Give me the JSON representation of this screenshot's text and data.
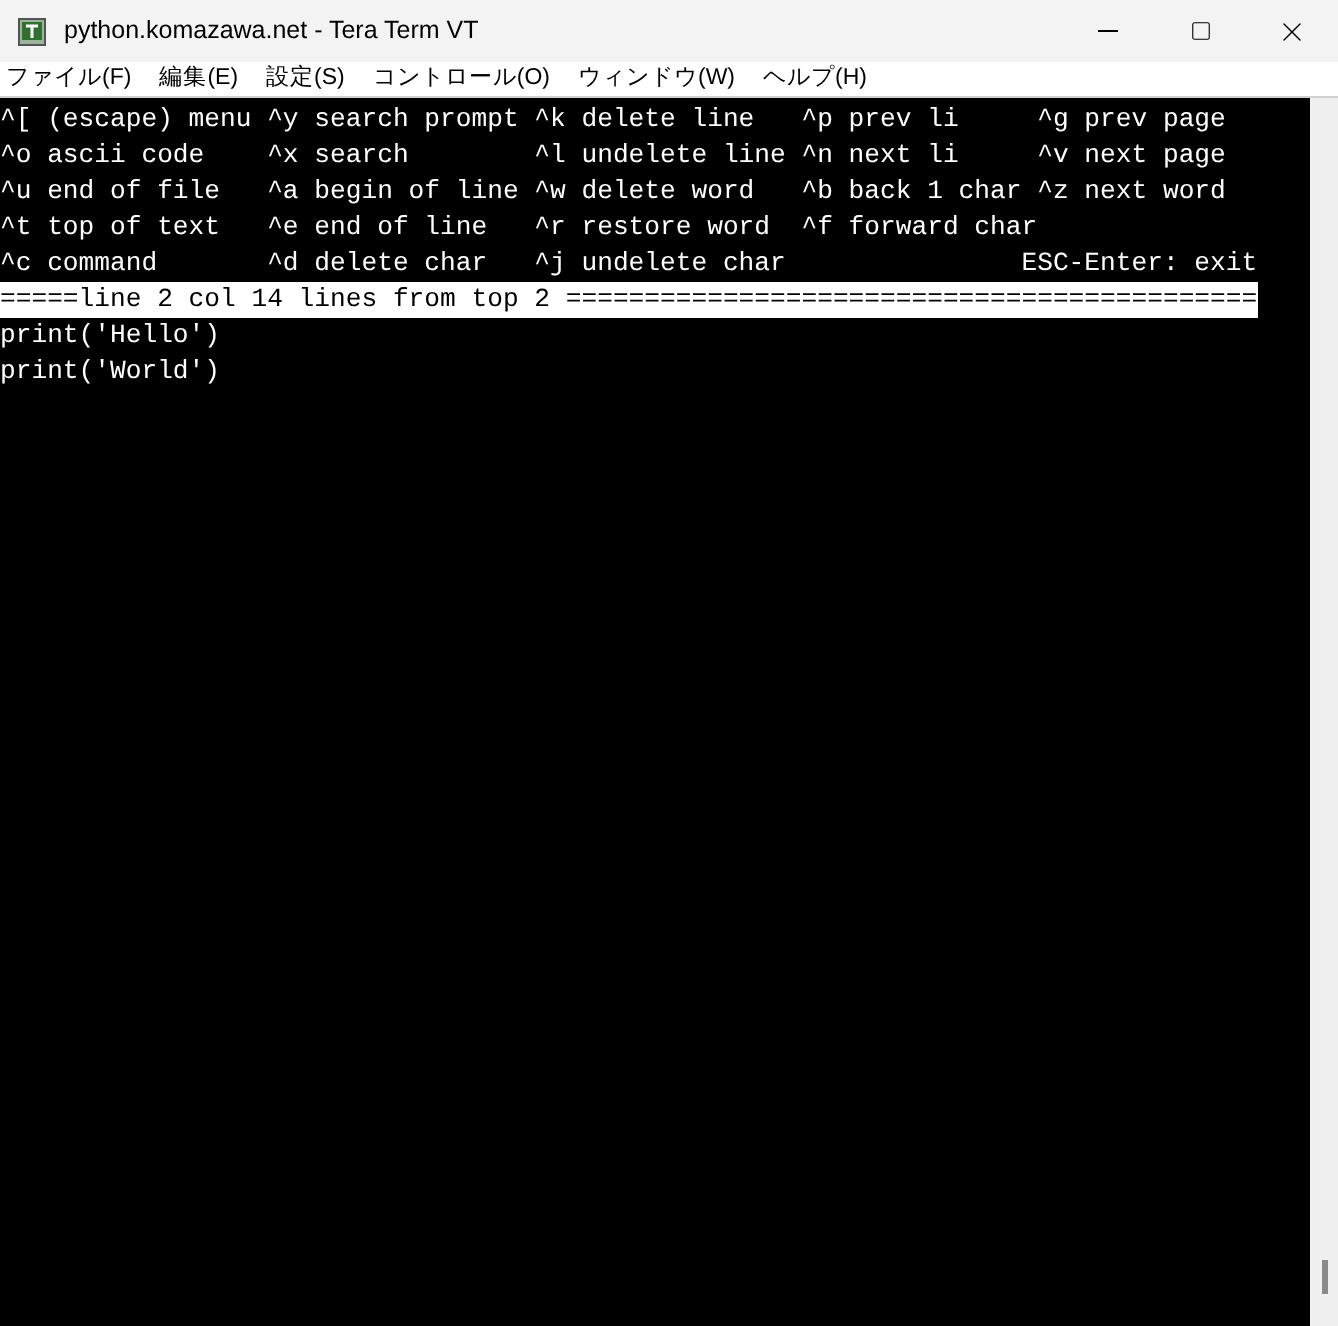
{
  "window": {
    "title": "python.komazawa.net - Tera Term VT"
  },
  "menu": [
    "ファイル(F)",
    "編集(E)",
    "設定(S)",
    "コントロール(O)",
    "ウィンドウ(W)",
    "ヘルプ(H)"
  ],
  "terminal": {
    "help_lines": [
      "^[ (escape) menu ^y search prompt ^k delete line   ^p prev li     ^g prev page",
      "^o ascii code    ^x search        ^l undelete line ^n next li     ^v next page",
      "^u end of file   ^a begin of line ^w delete word   ^b back 1 char ^z next word",
      "^t top of text   ^e end of line   ^r restore word  ^f forward char",
      "^c command       ^d delete char   ^j undelete char               ESC-Enter: exit"
    ],
    "status_line": "=====line 2 col 14 lines from top 2 ============================================",
    "buffer_lines": [
      "print('Hello')",
      "print('World')"
    ]
  }
}
